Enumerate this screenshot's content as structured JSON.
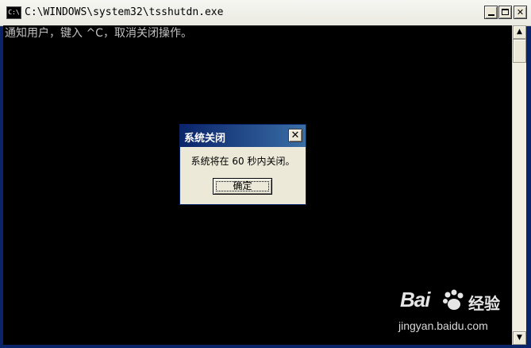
{
  "window": {
    "title": "C:\\WINDOWS\\system32\\tsshutdn.exe",
    "icon_label": "C:\\"
  },
  "console": {
    "lines": [
      "通知用户，键入 ^C，取消关闭操作。"
    ]
  },
  "dialog": {
    "title": "系统关闭",
    "message": "系统将在 60 秒内关闭。",
    "ok_label": "确定"
  },
  "watermark": {
    "logo": "Bai",
    "logo_suffix": "经验",
    "url": "jingyan.baidu.com"
  },
  "colors": {
    "console_bg": "#000000",
    "console_text": "#c0c0c0",
    "dialog_title_bg": "#0a246a",
    "dialog_face": "#ece9d8"
  }
}
